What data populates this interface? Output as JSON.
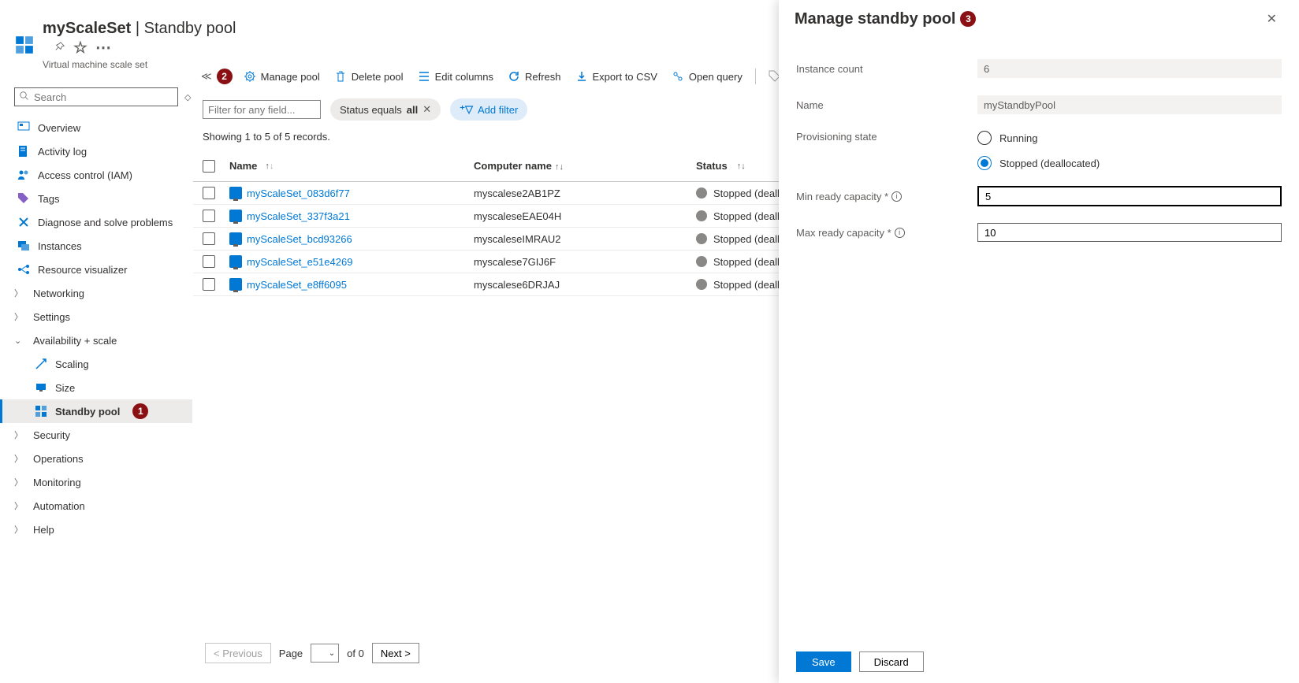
{
  "header": {
    "resource_name": "myScaleSet",
    "page_section": "Standby pool",
    "subtitle": "Virtual machine scale set"
  },
  "search": {
    "placeholder": "Search"
  },
  "nav": {
    "overview": "Overview",
    "activity_log": "Activity log",
    "access_control": "Access control (IAM)",
    "tags": "Tags",
    "diagnose": "Diagnose and solve problems",
    "instances": "Instances",
    "resource_viz": "Resource visualizer",
    "networking": "Networking",
    "settings": "Settings",
    "availability": "Availability + scale",
    "scaling": "Scaling",
    "size": "Size",
    "standby_pool": "Standby pool",
    "security": "Security",
    "operations": "Operations",
    "monitoring": "Monitoring",
    "automation": "Automation",
    "help": "Help"
  },
  "badges": {
    "nav_standby": "1",
    "manage_pool": "2",
    "panel_title": "3"
  },
  "toolbar": {
    "manage_pool": "Manage pool",
    "delete_pool": "Delete pool",
    "edit_columns": "Edit columns",
    "refresh": "Refresh",
    "export_csv": "Export to CSV",
    "open_query": "Open query",
    "assign_tags": "Assign tags"
  },
  "filters": {
    "placeholder": "Filter for any field...",
    "status_pill_prefix": "Status equals ",
    "status_pill_value": "all",
    "add_filter": "Add filter"
  },
  "records_text": "Showing 1 to 5 of 5 records.",
  "columns": {
    "name": "Name",
    "computer": "Computer name",
    "status": "Status"
  },
  "rows": [
    {
      "name": "myScaleSet_083d6f77",
      "computer": "myscalese2AB1PZ",
      "status": "Stopped (deall"
    },
    {
      "name": "myScaleSet_337f3a21",
      "computer": "myscaleseEAE04H",
      "status": "Stopped (deall"
    },
    {
      "name": "myScaleSet_bcd93266",
      "computer": "myscaleseIMRAU2",
      "status": "Stopped (deall"
    },
    {
      "name": "myScaleSet_e51e4269",
      "computer": "myscalese7GIJ6F",
      "status": "Stopped (deall"
    },
    {
      "name": "myScaleSet_e8ff6095",
      "computer": "myscalese6DRJAJ",
      "status": "Stopped (deall"
    }
  ],
  "pagination": {
    "prev": "< Previous",
    "page_label": "Page",
    "of": "of 0",
    "next": "Next >"
  },
  "panel": {
    "title": "Manage standby pool",
    "instance_count_label": "Instance count",
    "instance_count_value": "6",
    "name_label": "Name",
    "name_value": "myStandbyPool",
    "prov_state_label": "Provisioning state",
    "prov_running": "Running",
    "prov_stopped": "Stopped (deallocated)",
    "min_ready_label": "Min ready capacity *",
    "min_ready_value": "5",
    "max_ready_label": "Max ready capacity *",
    "max_ready_value": "10",
    "save": "Save",
    "discard": "Discard"
  }
}
